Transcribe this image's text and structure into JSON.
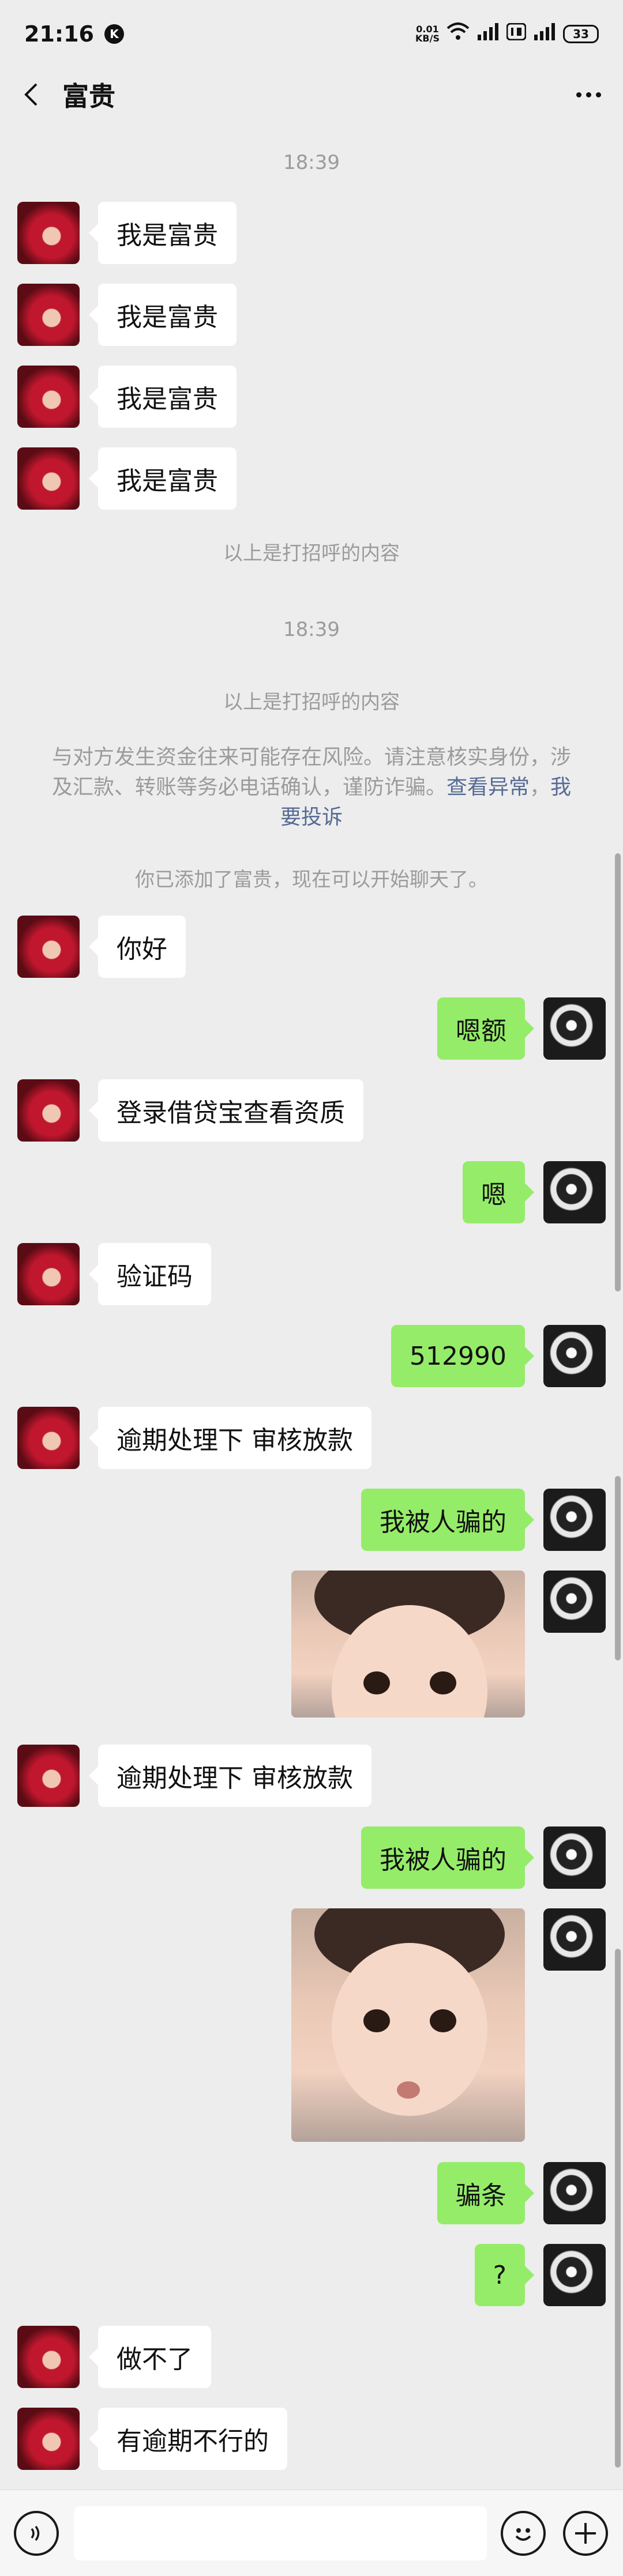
{
  "status": {
    "time": "21:16",
    "badge": "K",
    "speed_top": "0.01",
    "speed_bottom": "KB/S",
    "battery": "33"
  },
  "header": {
    "title": "富贵"
  },
  "system": {
    "time1": "18:39",
    "greet_note1": "以上是打招呼的内容",
    "time2": "18:39",
    "greet_note2": "以上是打招呼的内容",
    "warning_text": "与对方发生资金往来可能存在风险。请注意核实身份，涉及汇款、转账等务必电话确认，谨防诈骗。",
    "warning_link1": "查看异常",
    "warning_sep": "，",
    "warning_link2": "我要投诉",
    "added_note": "你已添加了富贵，现在可以开始聊天了。"
  },
  "messages": [
    {
      "side": "left",
      "text": "我是富贵"
    },
    {
      "side": "left",
      "text": "我是富贵"
    },
    {
      "side": "left",
      "text": "我是富贵"
    },
    {
      "side": "left",
      "text": "我是富贵"
    },
    {
      "side": "left",
      "text": "你好"
    },
    {
      "side": "right",
      "text": "嗯额"
    },
    {
      "side": "left",
      "text": "登录借贷宝查看资质"
    },
    {
      "side": "right",
      "text": "嗯"
    },
    {
      "side": "left",
      "text": "验证码"
    },
    {
      "side": "right",
      "text": "512990"
    },
    {
      "side": "left",
      "text": "逾期处理下 审核放款"
    },
    {
      "side": "right",
      "text": "我被人骗的"
    },
    {
      "side": "left",
      "text": "逾期处理下 审核放款"
    },
    {
      "side": "right",
      "text": "我被人骗的"
    },
    {
      "side": "right",
      "text": "骗条"
    },
    {
      "side": "right",
      "text": "?"
    },
    {
      "side": "left",
      "text": "做不了"
    },
    {
      "side": "left",
      "text": "有逾期不行的"
    }
  ],
  "input": {
    "placeholder": ""
  },
  "colors": {
    "bg": "#ededed",
    "bubble_self": "#95ec69",
    "bubble_other": "#ffffff",
    "link": "#576b95"
  },
  "icons": [
    "back-icon",
    "more-icon",
    "voice-icon",
    "emoji-icon",
    "plus-icon"
  ]
}
